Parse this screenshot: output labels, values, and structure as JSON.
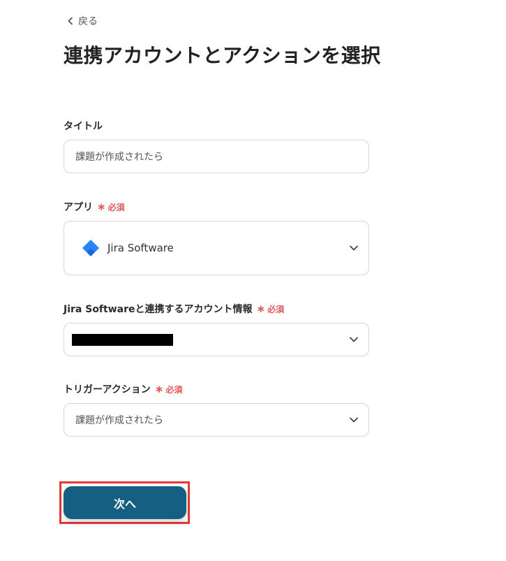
{
  "back": {
    "label": "戻る"
  },
  "page": {
    "title": "連携アカウントとアクションを選択"
  },
  "required_label": "必須",
  "fields": {
    "title": {
      "label": "タイトル",
      "value": "課題が作成されたら"
    },
    "app": {
      "label": "アプリ",
      "value": "Jira Software",
      "icon": "jira-software-logo"
    },
    "account": {
      "label": "Jira Softwareと連携するアカウント情報",
      "value_masked": true
    },
    "trigger": {
      "label": "トリガーアクション",
      "value": "課題が作成されたら"
    }
  },
  "next_button": {
    "label": "次へ"
  },
  "colors": {
    "primary_button": "#155f83",
    "required_text": "#e05a5a",
    "highlight_frame": "#e53935",
    "jira_blue": "#2684ff"
  }
}
